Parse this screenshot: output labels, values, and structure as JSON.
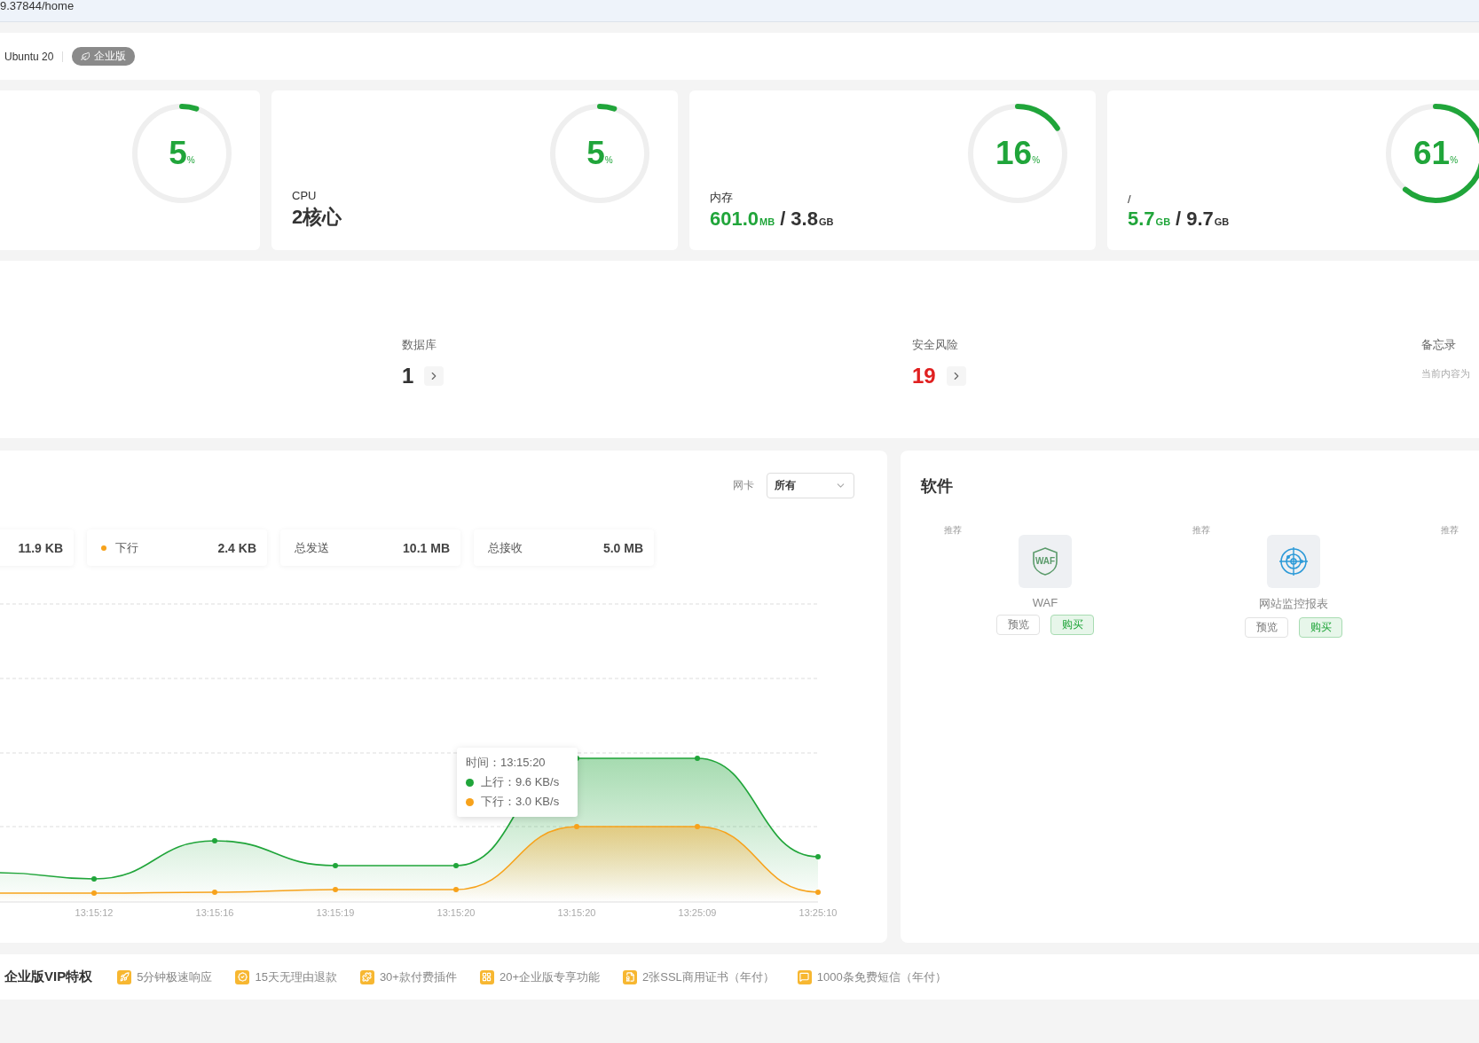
{
  "address": "9.37844/home",
  "header": {
    "os": "Ubuntu 20",
    "badge": "企业版"
  },
  "cards": [
    {
      "gauge": {
        "value": "5",
        "unit": "%",
        "level": 0.05
      }
    },
    {
      "label": "CPU",
      "value": [
        {
          "number": "2核心",
          "accent": false
        }
      ],
      "gauge": {
        "value": "5",
        "unit": "%",
        "level": 0.05
      }
    },
    {
      "label": "内存",
      "separator": "/",
      "value": [
        {
          "number": "601.0",
          "unit": "MB",
          "accent": true
        },
        {
          "number": "3.8",
          "unit": "GB",
          "accent": false
        }
      ],
      "gauge": {
        "value": "16",
        "unit": "%",
        "level": 0.16
      }
    },
    {
      "label": "/",
      "separator": "/",
      "value": [
        {
          "number": "5.7",
          "unit": "GB",
          "accent": true
        },
        {
          "number": "9.7",
          "unit": "GB",
          "accent": false
        }
      ],
      "gauge": {
        "value": "61",
        "unit": "%",
        "level": 0.61
      }
    }
  ],
  "overview": [
    {
      "kind": "count",
      "label": "数据库",
      "value": "1",
      "alert": false
    },
    {
      "kind": "count",
      "label": "安全风险",
      "value": "19",
      "alert": true
    },
    {
      "kind": "note",
      "label": "备忘录",
      "note": "当前内容为"
    }
  ],
  "network": {
    "nic_label": "网卡",
    "nic_value": "所有",
    "chips": [
      {
        "value": "11.9 KB"
      },
      {
        "label": "下行",
        "color": "#f7a21b",
        "value": "2.4 KB"
      },
      {
        "label": "总发送",
        "value": "10.1 MB"
      },
      {
        "label": "总接收",
        "value": "5.0 MB"
      }
    ],
    "x_labels": [
      "13:15:12",
      "13:15:16",
      "13:15:19",
      "13:15:20",
      "13:15:20",
      "13:25:09",
      "13:25:10"
    ],
    "tooltip": {
      "title": "时间：13:15:20",
      "rows": [
        {
          "text": "上行：9.6 KB/s",
          "color": "#20a53a"
        },
        {
          "text": "下行：3.0 KB/s",
          "color": "#f7a21b"
        }
      ]
    }
  },
  "software": {
    "title": "软件",
    "items": [
      {
        "tag": "推荐",
        "kind": "waf",
        "icon_text": "WAF",
        "name": "WAF",
        "buttons": [
          {
            "label": "预览",
            "kind": "outline"
          },
          {
            "label": "购买",
            "kind": "primary"
          }
        ]
      },
      {
        "tag": "推荐",
        "kind": "radar",
        "name": "网站监控报表",
        "buttons": [
          {
            "label": "预览",
            "kind": "outline"
          },
          {
            "label": "购买",
            "kind": "primary"
          }
        ]
      },
      {
        "tag": "推荐"
      }
    ]
  },
  "footer": {
    "title": "企业版VIP特权",
    "items": [
      {
        "kind": "rocket",
        "text": "5分钟极速响应"
      },
      {
        "kind": "badge",
        "text": "15天无理由退款"
      },
      {
        "kind": "puzzle",
        "text": "30+款付费插件"
      },
      {
        "kind": "grid",
        "text": "20+企业版专享功能"
      },
      {
        "kind": "certificate",
        "text": "2张SSL商用证书（年付）"
      },
      {
        "kind": "message",
        "text": "1000条免费短信（年付）"
      }
    ]
  }
}
